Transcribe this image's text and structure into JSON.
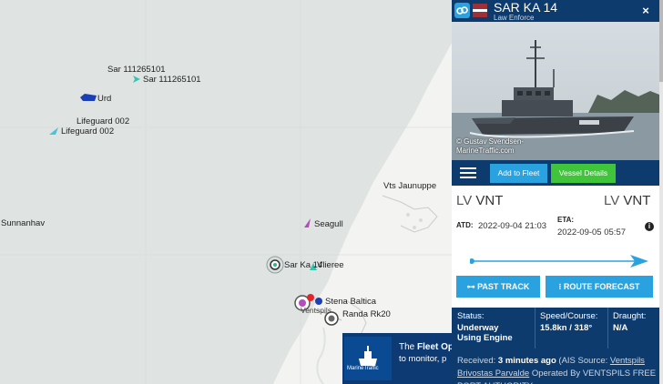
{
  "map": {
    "labels": {
      "sar_top": "Sar 111265101",
      "sar_second": "Sar 111265101",
      "urd": "Urd",
      "lifeguard_top": "Lifeguard 002",
      "lifeguard_second": "Lifeguard 002",
      "sunnanhav": "Sunnanhav",
      "vts": "Vts Jaunuppe",
      "seagull": "Seagull",
      "sar_ka_14": "Sar Ka 14",
      "vlieree": "Vlieree",
      "stena": "Stena Baltica",
      "randa": "Randa Rk20",
      "town": "Ventspils"
    }
  },
  "ad": {
    "logo_text": "MarineTraffic",
    "title_prefix": "The ",
    "title_bold": "Fleet Op",
    "subtitle": "to monitor, p"
  },
  "panel": {
    "vessel_name": "SAR KA 14",
    "vessel_type": "Law Enforce",
    "close_label": "×",
    "photo_credit_line1": "© Gustav Svendsen-",
    "photo_credit_line2": "MarineTraffic.com",
    "add_to_fleet": "Add to Fleet",
    "vessel_details": "Vessel Details",
    "departure": {
      "country": "LV",
      "code": "VNT"
    },
    "arrival": {
      "country": "LV",
      "code": "VNT"
    },
    "atd_label": "ATD:",
    "atd_value": "2022-09-04 21:03",
    "eta_label": "ETA:",
    "eta_value": "2022-09-05 05:57",
    "info_icon": "i",
    "past_track": "PAST TRACK",
    "route_forecast": "ROUTE FORECAST",
    "status": {
      "label": "Status:",
      "value_line1": "Underway",
      "value_line2": "Using Engine"
    },
    "speed": {
      "label": "Speed/Course:",
      "value": "15.8kn / 318°"
    },
    "draught": {
      "label": "Draught:",
      "value": "N/A"
    },
    "received_prefix": "Received: ",
    "received_bold": "3 minutes ago",
    "received_suffix": " (AIS Source:",
    "received_source": "Ventspils Brivostas Parvalde",
    "received_operated": " Operated By",
    "received_operator": "VENTSPILS FREE PORT AUTHORITY"
  },
  "colors": {
    "panel_header": "#0e3b6d",
    "accent_blue": "#2ba2e0",
    "accent_green": "#3fc43a",
    "sea": "#dfe3e2",
    "land": "#f3f3f1"
  }
}
